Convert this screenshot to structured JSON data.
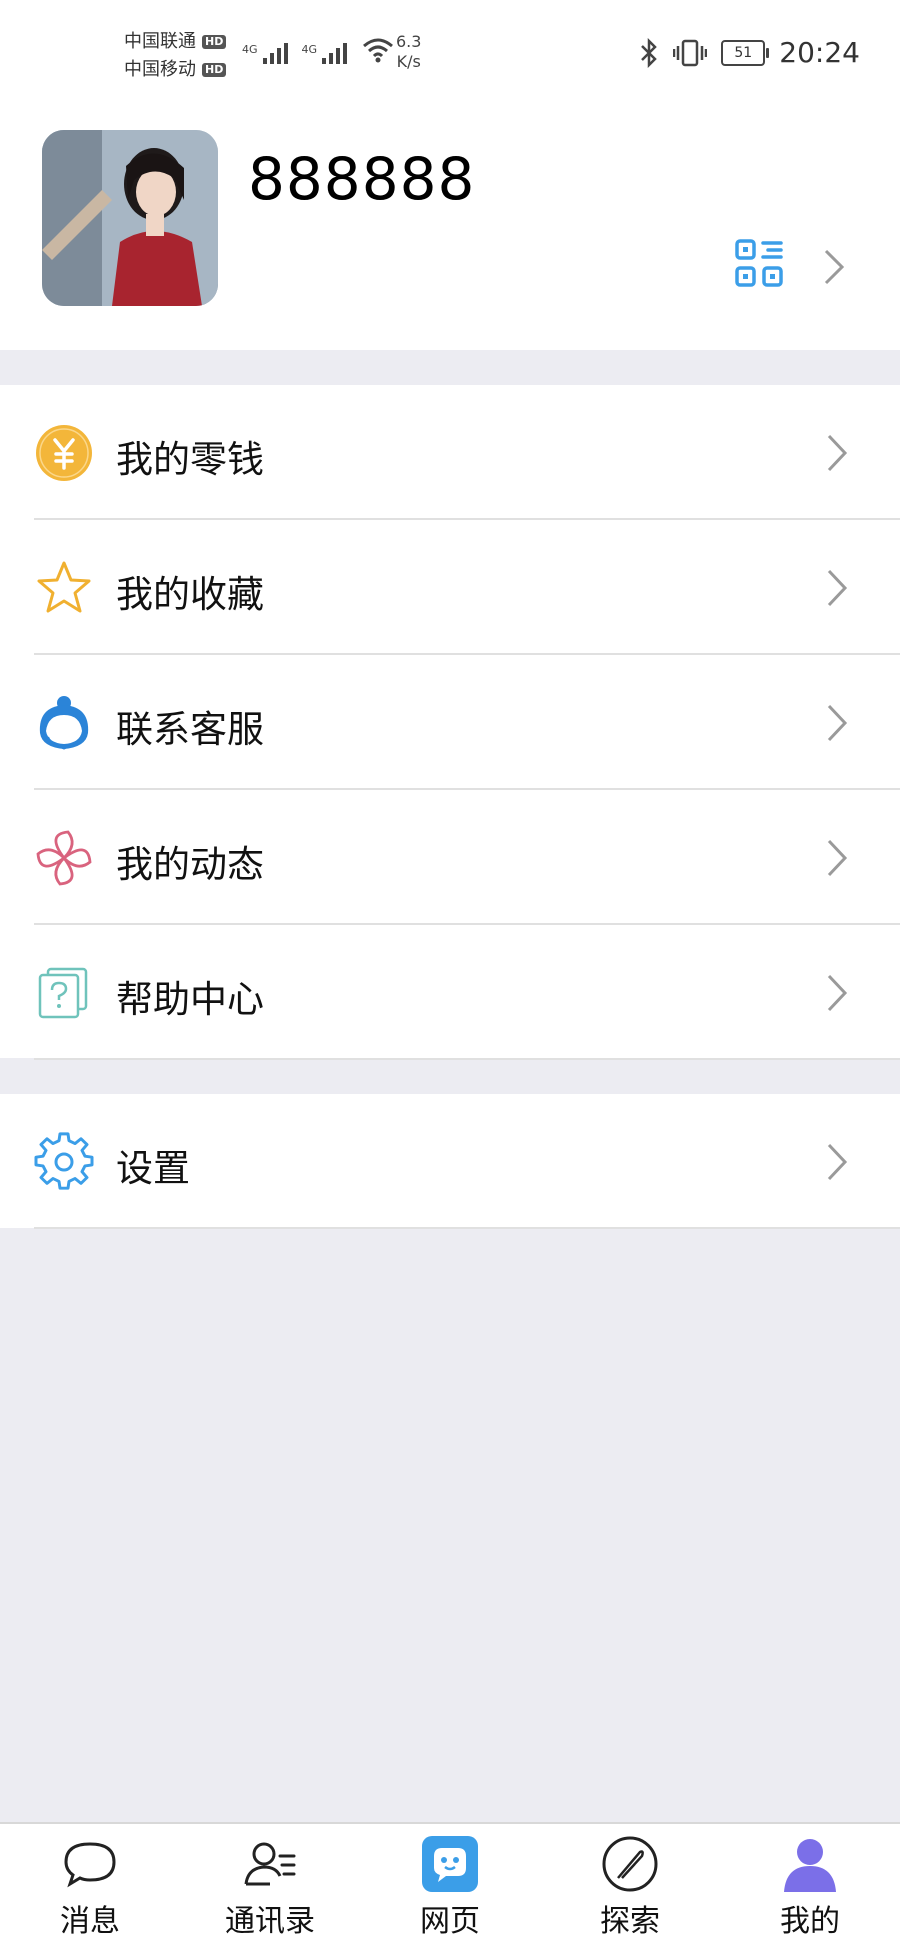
{
  "status_bar": {
    "carrier1": "中国联通",
    "carrier2": "中国移动",
    "hd": "HD",
    "net_tag": "4G",
    "speed_value": "6.3",
    "speed_unit": "K/s",
    "battery": "51",
    "time": "20:24"
  },
  "profile": {
    "username": "888888"
  },
  "menu": {
    "wallet": "我的零钱",
    "favorites": "我的收藏",
    "support": "联系客服",
    "moments": "我的动态",
    "help": "帮助中心",
    "settings": "设置"
  },
  "tabbar": {
    "messages": "消息",
    "contacts": "通讯录",
    "web": "网页",
    "discover": "探索",
    "me": "我的"
  },
  "colors": {
    "accent_blue": "#3b9ee8",
    "wallet_gold": "#f3b63a",
    "moments_pink": "#d9637e",
    "tab_active": "#7b6fe8"
  }
}
